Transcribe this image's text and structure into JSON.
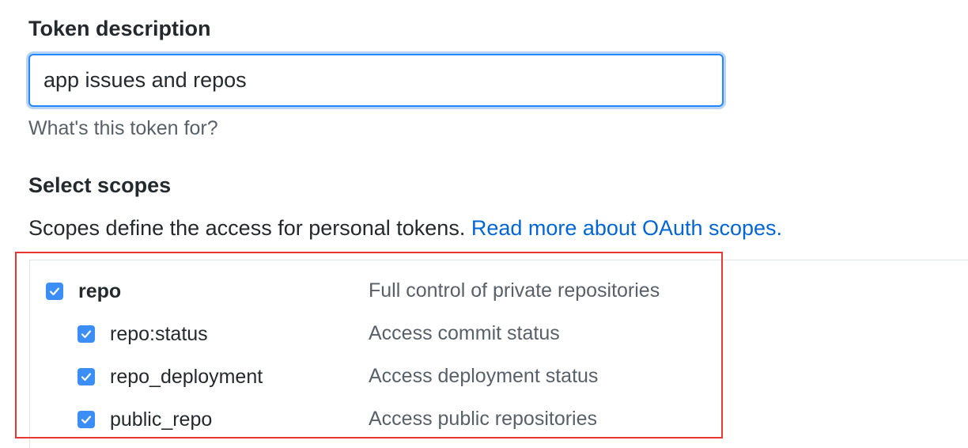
{
  "token": {
    "label": "Token description",
    "value": "app issues and repos",
    "note": "What's this token for?"
  },
  "scopes": {
    "label": "Select scopes",
    "description": "Scopes define the access for personal tokens. ",
    "link_text": "Read more about OAuth scopes.",
    "items": [
      {
        "name": "repo",
        "description": "Full control of private repositories",
        "checked": true
      },
      {
        "name": "repo:status",
        "description": "Access commit status",
        "checked": true
      },
      {
        "name": "repo_deployment",
        "description": "Access deployment status",
        "checked": true
      },
      {
        "name": "public_repo",
        "description": "Access public repositories",
        "checked": true
      }
    ]
  },
  "colors": {
    "accent": "#0366d6",
    "checkbox": "#3a8ef6",
    "highlight": "#e8382f"
  }
}
